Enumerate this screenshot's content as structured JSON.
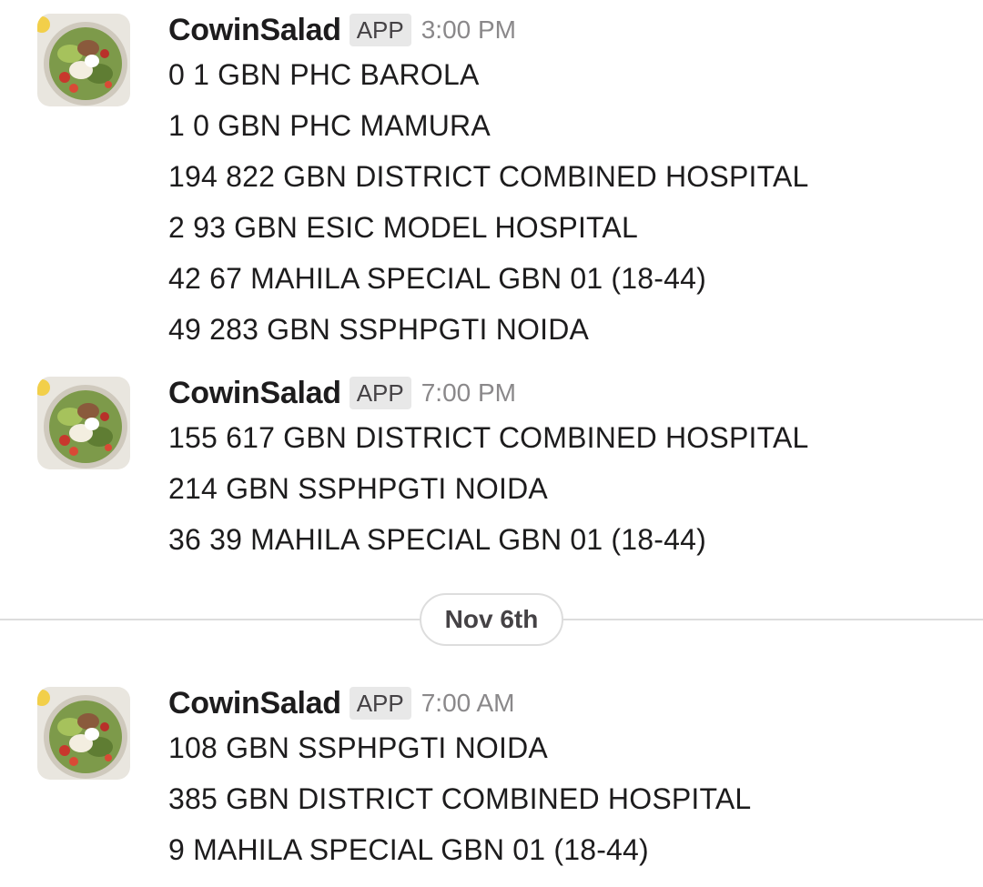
{
  "messages": [
    {
      "sender": "CowinSalad",
      "badge": "APP",
      "time": "3:00 PM",
      "lines": [
        "0 1 GBN PHC BAROLA",
        "1 0 GBN PHC MAMURA",
        "194 822 GBN DISTRICT COMBINED HOSPITAL",
        "2 93 GBN ESIC MODEL HOSPITAL",
        "42 67 MAHILA SPECIAL GBN 01 (18-44)",
        "49 283 GBN SSPHPGTI NOIDA"
      ]
    },
    {
      "sender": "CowinSalad",
      "badge": "APP",
      "time": "7:00 PM",
      "lines": [
        "155 617 GBN DISTRICT COMBINED HOSPITAL",
        "214 GBN SSPHPGTI NOIDA",
        "36 39 MAHILA SPECIAL GBN 01 (18-44)"
      ]
    },
    {
      "sender": "CowinSalad",
      "badge": "APP",
      "time": "7:00 AM",
      "lines": [
        "108 GBN SSPHPGTI NOIDA",
        "385 GBN DISTRICT COMBINED HOSPITAL",
        "9 MAHILA SPECIAL GBN 01 (18-44)"
      ]
    }
  ],
  "day_divider": {
    "label": "Nov 6th"
  },
  "avatar": {
    "icon": "salad-bowl-icon"
  }
}
